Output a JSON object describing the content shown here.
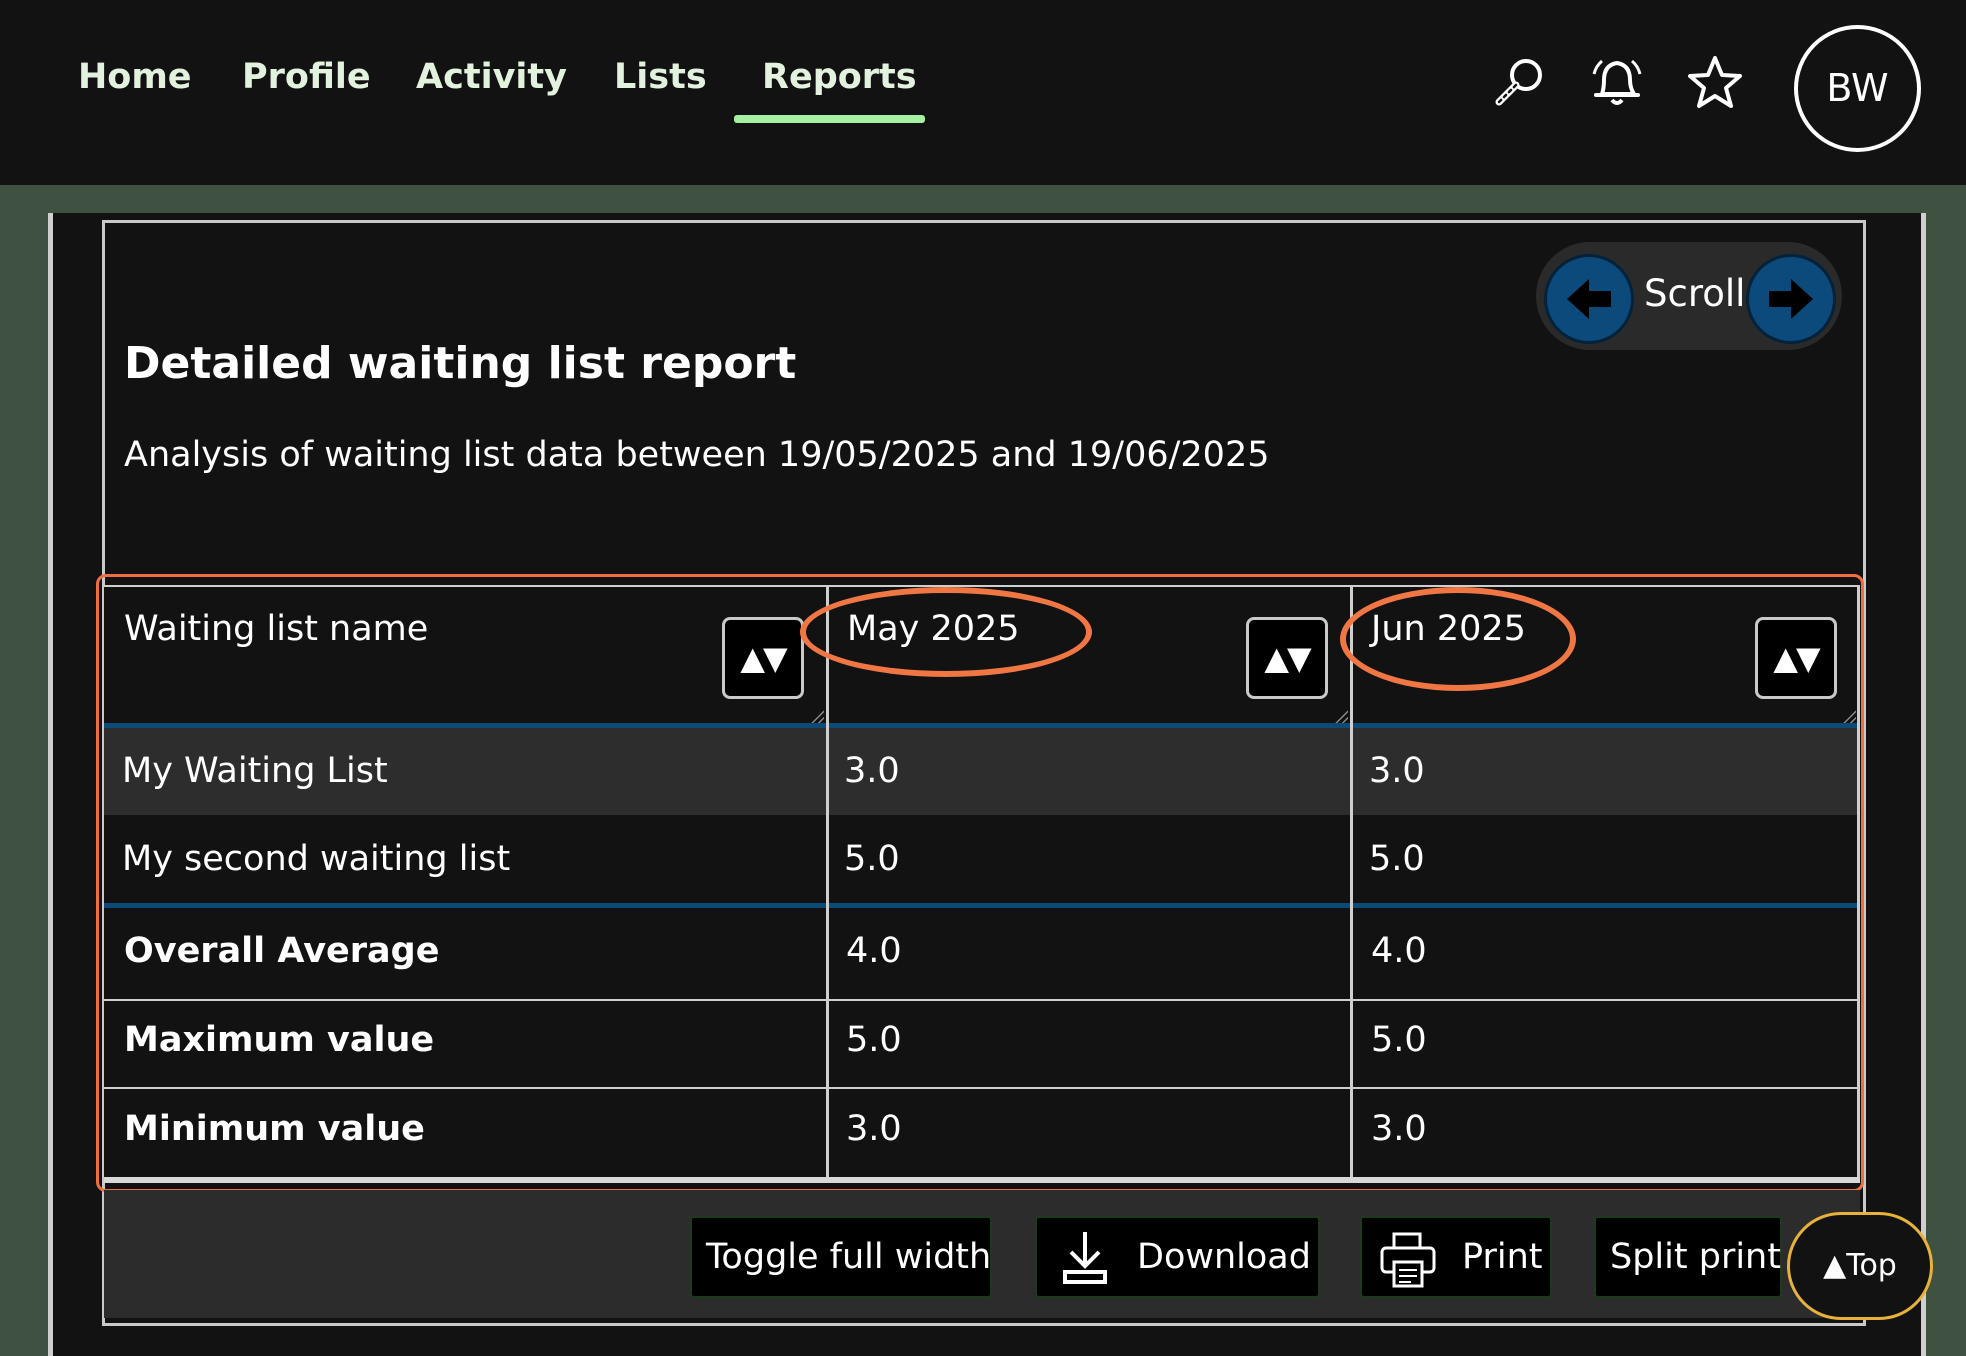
{
  "nav": {
    "items": [
      {
        "label": "Home"
      },
      {
        "label": "Profile"
      },
      {
        "label": "Activity"
      },
      {
        "label": "Lists"
      },
      {
        "label": "Reports"
      }
    ],
    "active": "Reports",
    "icons": [
      "search-icon",
      "bell-icon",
      "star-icon"
    ],
    "avatar_initials": "BW"
  },
  "scroll": {
    "label": "Scroll"
  },
  "report": {
    "title": "Detailed waiting list report",
    "subtitle": "Analysis of waiting list data between 19/05/2025 and 19/06/2025"
  },
  "table": {
    "headers": [
      "Waiting list name",
      "May 2025",
      "Jun 2025"
    ],
    "sort_glyph": "▲▼",
    "rows": [
      [
        "My Waiting List",
        "3.0",
        "3.0"
      ],
      [
        "My second waiting list",
        "5.0",
        "5.0"
      ]
    ],
    "summary": [
      [
        "Overall Average",
        "4.0",
        "4.0"
      ],
      [
        "Maximum value",
        "5.0",
        "5.0"
      ],
      [
        "Minimum value",
        "3.0",
        "3.0"
      ]
    ]
  },
  "toolbar": {
    "toggle_label": "Toggle full width",
    "download_label": "Download",
    "print_label": "Print",
    "split_print_label": "Split print",
    "top_label": "▲Top"
  },
  "colors": {
    "nav_bg": "#121212",
    "page_bg": "#3f5140",
    "active_underline": "#a7f0a3",
    "scroll_button": "#0b4a7a",
    "divider_blue": "#0c4a78",
    "annotation": "#ef6f3f",
    "top_button_border": "#e8b23a"
  }
}
